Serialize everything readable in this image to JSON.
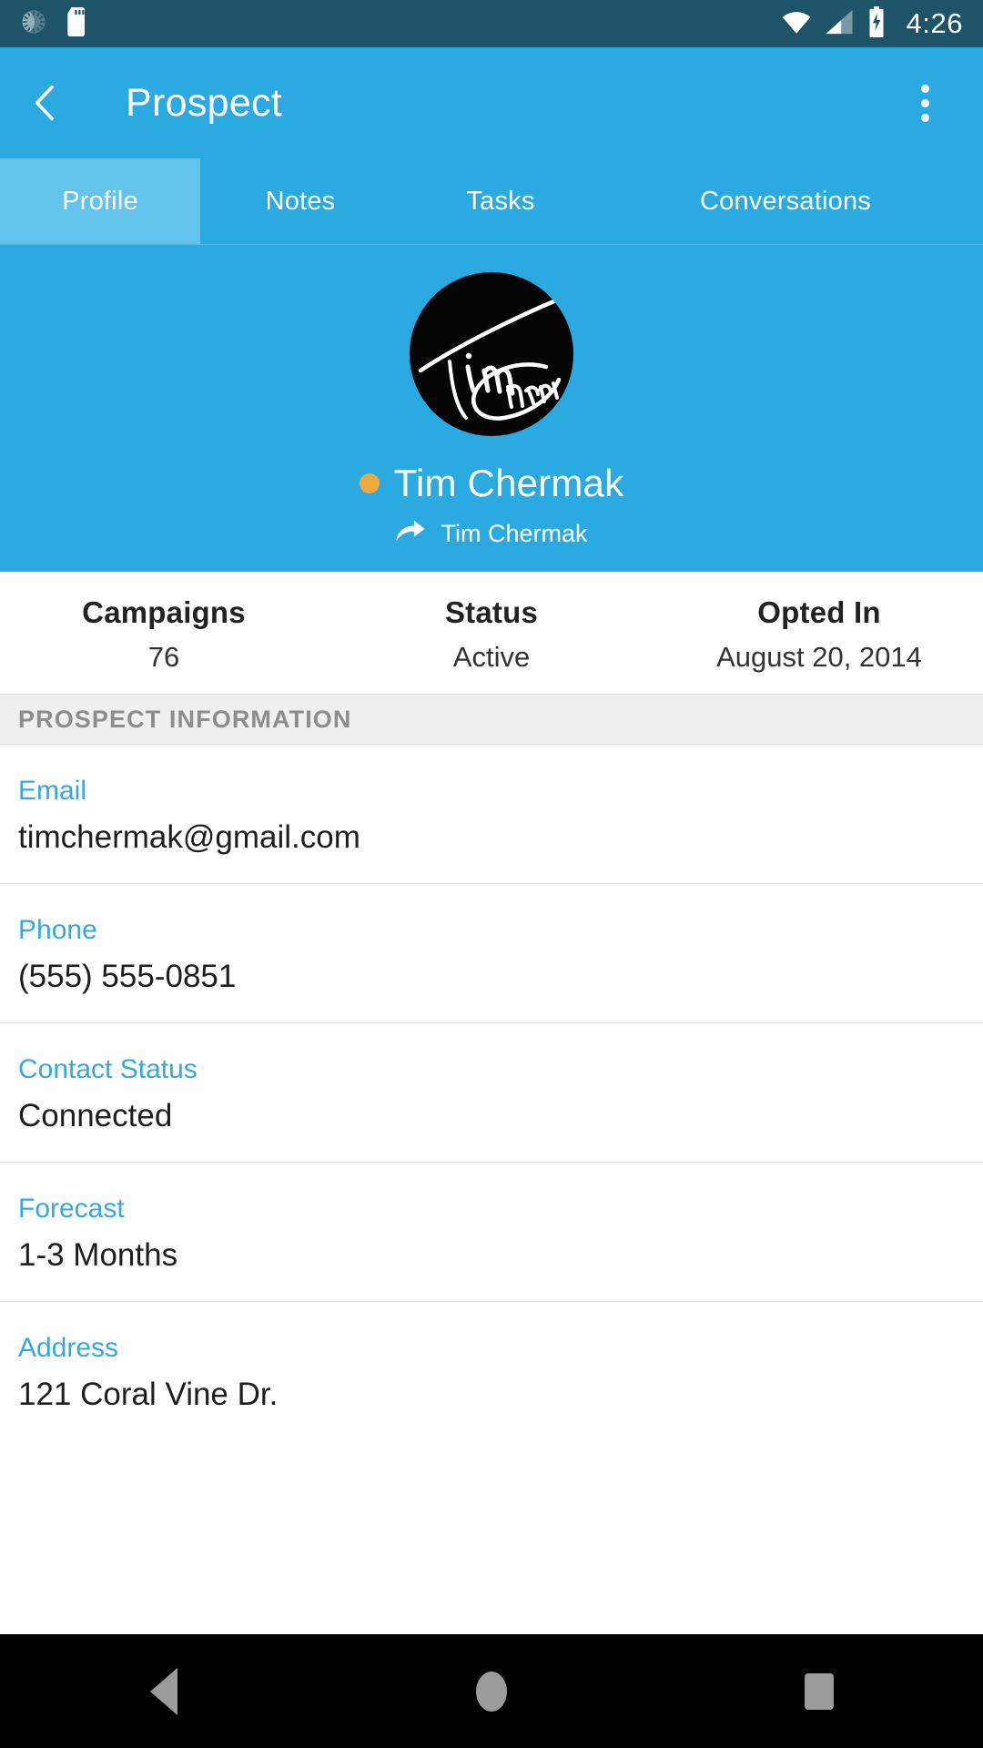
{
  "status_bar": {
    "icons_left": [
      "brightness-gauge-icon",
      "sd-card-icon"
    ],
    "icons_right": [
      "wifi-icon",
      "cell-signal-icon",
      "battery-charging-icon"
    ],
    "time": "4:26",
    "background_color": "#1d5468"
  },
  "app_bar": {
    "back_icon": "back-arrow-icon",
    "title": "Prospect",
    "overflow_icon": "overflow-menu-icon",
    "background_color": "#2BAAE2"
  },
  "tabs": {
    "selected": "Profile",
    "selected_background": "#63C3EA",
    "items": [
      {
        "label": "Profile"
      },
      {
        "label": "Notes"
      },
      {
        "label": "Tasks"
      },
      {
        "label": "Conversations"
      }
    ]
  },
  "hero": {
    "avatar_alt": "Tim Chermak signature avatar",
    "status_dot_color": "#F0A93F",
    "name": "Tim Chermak",
    "share_icon": "share-arrow-icon",
    "owner": "Tim Chermak"
  },
  "stats": [
    {
      "key": "Campaigns",
      "value": "76"
    },
    {
      "key": "Status",
      "value": "Active"
    },
    {
      "key": "Opted In",
      "value": "August 20, 2014"
    }
  ],
  "section": {
    "title": "PROSPECT INFORMATION"
  },
  "info_rows": [
    {
      "label": "Email",
      "value": "timchermak@gmail.com"
    },
    {
      "label": "Phone",
      "value": "(555) 555-0851"
    },
    {
      "label": "Contact Status",
      "value": "Connected"
    },
    {
      "label": "Forecast",
      "value": "1-3 Months"
    },
    {
      "label": "Address",
      "value": "121 Coral Vine Dr."
    }
  ],
  "nav_bar": {
    "back": "nav-back-icon",
    "home": "nav-home-icon",
    "recents": "nav-recents-icon"
  }
}
